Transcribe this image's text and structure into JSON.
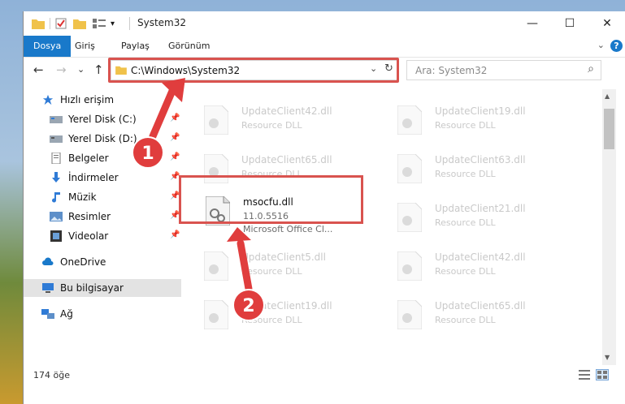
{
  "window": {
    "title": "System32",
    "minimize": "—",
    "maximize": "☐",
    "close": "✕"
  },
  "ribbon": {
    "tabs": [
      "Dosya",
      "Giriş",
      "Paylaş",
      "Görünüm"
    ],
    "help": "?",
    "chevron": "⌄"
  },
  "nav": {
    "back": "←",
    "forward": "→",
    "history": "⌄",
    "up": "↑",
    "address": "C:\\Windows\\System32",
    "address_dropdown": "⌄",
    "refresh": "↻",
    "search_placeholder": "Ara: System32",
    "search_icon": "⌕"
  },
  "sidebar": {
    "items": [
      {
        "label": "Hızlı erişim",
        "icon": "star-icon"
      },
      {
        "label": "Yerel Disk (C:)",
        "icon": "drive-icon"
      },
      {
        "label": "Yerel Disk (D:)",
        "icon": "drive-icon"
      },
      {
        "label": "Belgeler",
        "icon": "document-icon"
      },
      {
        "label": "İndirmeler",
        "icon": "download-icon"
      },
      {
        "label": "Müzik",
        "icon": "music-icon"
      },
      {
        "label": "Resimler",
        "icon": "picture-icon"
      },
      {
        "label": "Videolar",
        "icon": "video-icon"
      },
      {
        "label": "OneDrive",
        "icon": "cloud-icon"
      },
      {
        "label": "Bu bilgisayar",
        "icon": "computer-icon"
      },
      {
        "label": "Ağ",
        "icon": "network-icon"
      }
    ]
  },
  "files": {
    "left": [
      {
        "name": "UpdateClient42.dll",
        "desc": "Resource DLL"
      },
      {
        "name": "UpdateClient65.dll",
        "desc": "Resource DLL"
      },
      {
        "name": "msocfu.dll",
        "version": "11.0.5516",
        "desc": "Microsoft Office Cl..."
      },
      {
        "name": "UpdateClient5.dll",
        "desc": "Resource DLL"
      },
      {
        "name": "UpdateClient19.dll",
        "desc": "Resource DLL"
      }
    ],
    "right": [
      {
        "name": "UpdateClient19.dll",
        "desc": "Resource DLL"
      },
      {
        "name": "UpdateClient63.dll",
        "desc": "Resource DLL"
      },
      {
        "name": "UpdateClient21.dll",
        "desc": "Resource DLL"
      },
      {
        "name": "UpdateClient42.dll",
        "desc": "Resource DLL"
      },
      {
        "name": "UpdateClient65.dll",
        "desc": "Resource DLL"
      }
    ]
  },
  "status": {
    "count": "174 öğe"
  },
  "badges": [
    "1",
    "2"
  ],
  "colors": {
    "accent": "#1979ca",
    "highlight": "#d9534f",
    "badge": "#e03d3d"
  }
}
